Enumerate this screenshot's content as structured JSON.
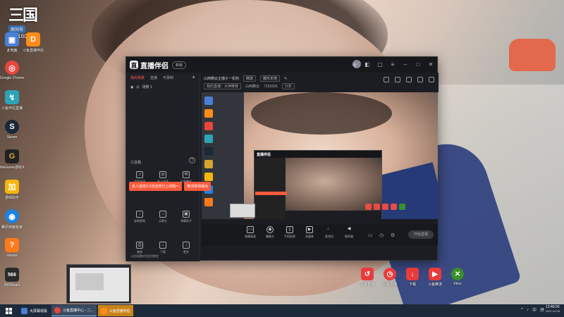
{
  "desktop": {
    "logo": {
      "big": "三国",
      "tag": "房间号",
      "room": "7151600"
    },
    "icons": [
      {
        "name": "computer",
        "label": "此电脑",
        "color": "#4a7fd4",
        "glyph": "▣"
      },
      {
        "name": "duo-screen",
        "label": "斗鱼直播伴侣",
        "color": "#ff8c1a",
        "glyph": "D"
      },
      {
        "name": "chrome",
        "label": "Google Chrome",
        "color": "#e8453c",
        "glyph": "◎"
      },
      {
        "name": "live-app",
        "label": "斗鱼伴侣直播",
        "color": "#2ca3b7",
        "glyph": "↯"
      },
      {
        "name": "steam",
        "label": "Steam",
        "color": "#1b2838",
        "glyph": "S"
      },
      {
        "name": "wegame",
        "label": "WeGame游戏平台",
        "color": "#d7a531",
        "glyph": "G"
      },
      {
        "name": "game-accel",
        "label": "游戏助手",
        "color": "#f5b50a",
        "glyph": "加"
      },
      {
        "name": "tencent",
        "label": "腾讯电脑管家",
        "color": "#1c83e1",
        "glyph": "◉"
      },
      {
        "name": "master",
        "label": "master",
        "color": "#ff7a1a",
        "glyph": "?"
      },
      {
        "name": "s66",
        "label": "566Steam",
        "color": "#2b2b2b",
        "glyph": "566"
      }
    ],
    "dock_icons": [
      {
        "name": "douyu-live",
        "label": "斗鱼直播",
        "color": "#e93b3b",
        "glyph": "↺"
      },
      {
        "name": "douyu-record",
        "label": "斗鱼录播",
        "color": "#e93b3b",
        "glyph": "◷"
      },
      {
        "name": "download",
        "label": "下载",
        "color": "#e93b3b",
        "glyph": "↓"
      },
      {
        "name": "douyu-push",
        "label": "斗鱼推流",
        "color": "#e93b3b",
        "glyph": "▶"
      },
      {
        "name": "xbox",
        "label": "Xbox",
        "color": "#3a8f2c",
        "glyph": "✕"
      }
    ]
  },
  "app": {
    "name": "直播伴侣",
    "version": "新版",
    "left_tabs": [
      "我的场景",
      "直播",
      "可录制"
    ],
    "scene": "场景 1",
    "tools_title": "工具箱",
    "tools": [
      {
        "name": "voice",
        "label": "语音连线",
        "glyph": "♫"
      },
      {
        "name": "multi",
        "label": "多人连麦",
        "glyph": "◎"
      },
      {
        "name": "gift",
        "label": "礼物播报",
        "glyph": "✉"
      },
      {
        "name": "record",
        "label": "录制视频",
        "glyph": "↓"
      },
      {
        "name": "music",
        "label": "点歌台",
        "glyph": "↓"
      },
      {
        "name": "effect",
        "label": "弹幕助手",
        "glyph": "▣"
      },
      {
        "name": "beauty",
        "label": "美颜",
        "glyph": "⎙"
      },
      {
        "name": "dl",
        "label": "下载",
        "glyph": "↓"
      },
      {
        "name": "more",
        "label": "更多",
        "glyph": "↓"
      }
    ],
    "promo_left": "多人连麦3·5活动现已上线啦～",
    "promo_right": "推流等待播出",
    "footer": "斗鱼直播伴侣使用教程",
    "header": {
      "title": "山西腾云主播子一机构",
      "edit": "修改",
      "category": "娱乐天地",
      "tag": "我的直播：大神推荐",
      "room_label": "山西腾云",
      "room_no": "7151600",
      "share": "分享"
    },
    "bottom_buttons": [
      {
        "name": "screen",
        "label": "直播画面",
        "glyph": "▭"
      },
      {
        "name": "camera",
        "label": "摄像头",
        "glyph": "◉"
      },
      {
        "name": "phone",
        "label": "手机投屏",
        "glyph": "▯"
      },
      {
        "name": "media",
        "label": "多媒体",
        "glyph": "▶"
      },
      {
        "name": "mic",
        "label": "麦克风",
        "glyph": "♩"
      },
      {
        "name": "speaker",
        "label": "扬声器",
        "glyph": "◀"
      }
    ],
    "go_live": "开始直播"
  },
  "taskbar": {
    "items": [
      {
        "name": "explorer",
        "label": "大屏幕观看",
        "color": "#4a7fd4",
        "state": "normal"
      },
      {
        "name": "browser",
        "label": "斗鱼直播中心 - 二...",
        "color": "#e8453c",
        "state": "active"
      },
      {
        "name": "live",
        "label": "斗鱼直播伴侣",
        "color": "#ff8c1a",
        "state": "hl"
      }
    ],
    "tray": [
      "^",
      "♪",
      "中",
      "拼"
    ],
    "time": "13:46:00",
    "date": "2022-04-08"
  }
}
